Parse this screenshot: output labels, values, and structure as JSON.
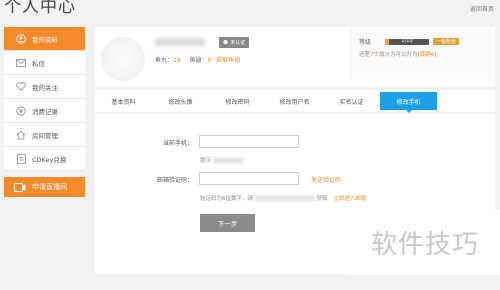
{
  "page": {
    "title": "个人中心",
    "back_link": "返回首页"
  },
  "sidebar": {
    "items": [
      {
        "label": "我的资料",
        "icon": "user-icon",
        "active": true
      },
      {
        "label": "私信",
        "icon": "mail-icon"
      },
      {
        "label": "我的关注",
        "icon": "heart-icon"
      },
      {
        "label": "消费记录",
        "icon": "coin-icon"
      },
      {
        "label": "房间管理",
        "icon": "home-icon"
      },
      {
        "label": "CDKey兑换",
        "icon": "card-icon"
      }
    ],
    "apply_label": "申请直播间"
  },
  "profile": {
    "verify_label": "未认证",
    "stats": {
      "label1": "鱼丸：",
      "value1": "28",
      "label2": "鱼翅：",
      "value2": "0",
      "link": "获取鱼翅"
    },
    "level": {
      "label": "等级",
      "progress_text": "1/10",
      "progress": 0.1,
      "badge": "一级粉丝",
      "tip_prefix": "还差",
      "tip_highlight1": "7",
      "tip_mid": "个战斗力可以升为",
      "tip_highlight2": "[黄铜4]"
    }
  },
  "tabs": [
    "基本资料",
    "修改头像",
    "修改密码",
    "修改用户名",
    "实名认证",
    "修改手机"
  ],
  "form": {
    "current_phone_label": "当前手机：",
    "tip_label": "提示",
    "email_code_label": "邮箱验证码：",
    "send_code_label": "发送验证码",
    "code_tip_prefix": "验证码为6位数字，请",
    "code_tip_suffix": "获取",
    "enter_email_label": "立即进入邮箱",
    "submit_label": "下一步"
  },
  "watermark": "软件技巧",
  "colors": {
    "accent": "#f58a2a",
    "tab_active": "#1fa0e6",
    "button": "#8c8c8c"
  }
}
